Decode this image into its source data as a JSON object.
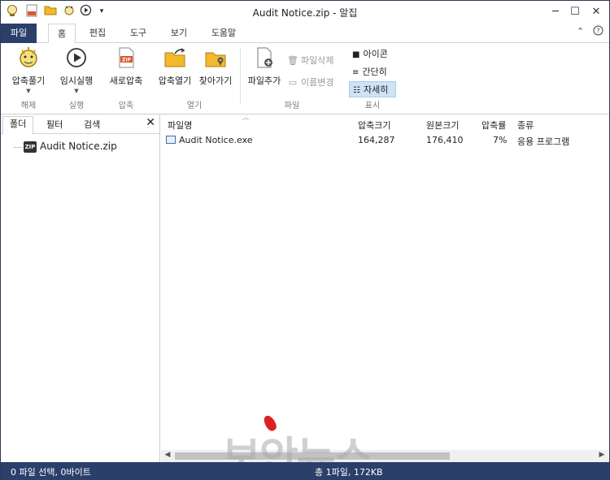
{
  "window": {
    "title": "Audit Notice.zip - 알집"
  },
  "quick_access": [
    "app-icon",
    "zip-new-icon",
    "folder-open-icon",
    "extract-icon",
    "play-icon",
    "customize-dropdown-icon"
  ],
  "tabs": {
    "file": "파일",
    "home": "홈",
    "edit": "편집",
    "tools": "도구",
    "view": "보기",
    "help": "도움말"
  },
  "ribbon": {
    "extract": {
      "label": "압축풀기",
      "group": "해제"
    },
    "temp_run": {
      "label": "임시실행",
      "group": "실행"
    },
    "new_zip": {
      "label": "새로압축",
      "group": "압축"
    },
    "open_archive": {
      "label": "압축열기"
    },
    "browse": {
      "label": "찾아가기"
    },
    "open_group": "열기",
    "add_file": {
      "label": "파일추가"
    },
    "delete_file": {
      "label": "파일삭제"
    },
    "rename": {
      "label": "이름변경"
    },
    "file_group": "파일",
    "view_icons": "아이콘",
    "view_simple": "간단히",
    "view_detail": "자세히",
    "view_group": "표시"
  },
  "left_pane": {
    "tabs": [
      "폴더",
      "필터",
      "검색"
    ],
    "tree_item": "Audit Notice.zip",
    "zip_badge": "ZIP"
  },
  "file_list": {
    "columns": [
      "파일명",
      "압축크기",
      "원본크기",
      "압축률",
      "종류"
    ],
    "rows": [
      {
        "name": "Audit Notice.exe",
        "packed": "164,287",
        "original": "176,410",
        "ratio": "7%",
        "type": "응용 프로그램"
      }
    ]
  },
  "watermark": "보안뉴스",
  "status": {
    "selection": "0 파일 선택, 0바이트",
    "total": "총 1파일, 172KB"
  },
  "colors": {
    "accent": "#2b3f6b",
    "selected_view": "#cfe3f6"
  }
}
